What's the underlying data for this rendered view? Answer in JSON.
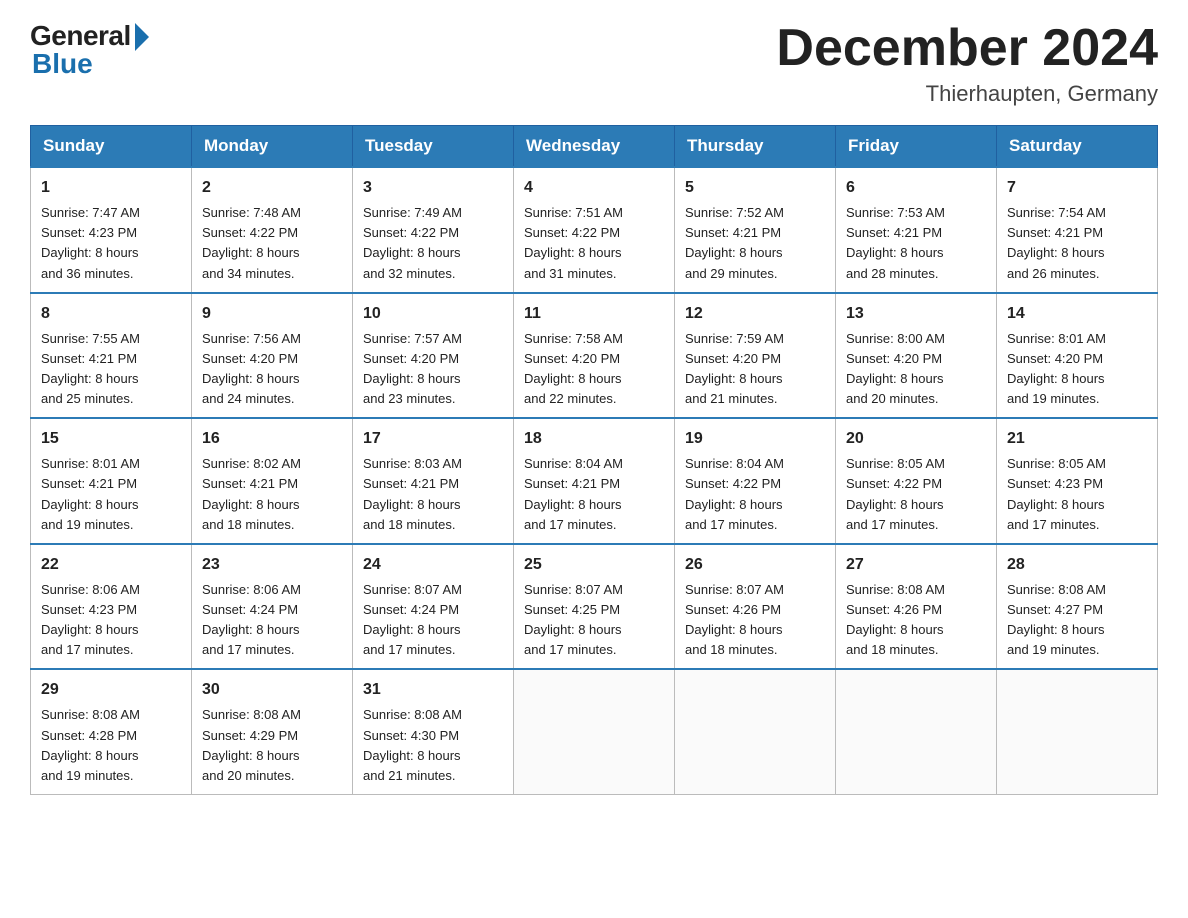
{
  "header": {
    "logo_general": "General",
    "logo_blue": "Blue",
    "month_title": "December 2024",
    "location": "Thierhaupten, Germany"
  },
  "days_of_week": [
    "Sunday",
    "Monday",
    "Tuesday",
    "Wednesday",
    "Thursday",
    "Friday",
    "Saturday"
  ],
  "weeks": [
    [
      {
        "num": "1",
        "sunrise": "7:47 AM",
        "sunset": "4:23 PM",
        "daylight": "8 hours and 36 minutes."
      },
      {
        "num": "2",
        "sunrise": "7:48 AM",
        "sunset": "4:22 PM",
        "daylight": "8 hours and 34 minutes."
      },
      {
        "num": "3",
        "sunrise": "7:49 AM",
        "sunset": "4:22 PM",
        "daylight": "8 hours and 32 minutes."
      },
      {
        "num": "4",
        "sunrise": "7:51 AM",
        "sunset": "4:22 PM",
        "daylight": "8 hours and 31 minutes."
      },
      {
        "num": "5",
        "sunrise": "7:52 AM",
        "sunset": "4:21 PM",
        "daylight": "8 hours and 29 minutes."
      },
      {
        "num": "6",
        "sunrise": "7:53 AM",
        "sunset": "4:21 PM",
        "daylight": "8 hours and 28 minutes."
      },
      {
        "num": "7",
        "sunrise": "7:54 AM",
        "sunset": "4:21 PM",
        "daylight": "8 hours and 26 minutes."
      }
    ],
    [
      {
        "num": "8",
        "sunrise": "7:55 AM",
        "sunset": "4:21 PM",
        "daylight": "8 hours and 25 minutes."
      },
      {
        "num": "9",
        "sunrise": "7:56 AM",
        "sunset": "4:20 PM",
        "daylight": "8 hours and 24 minutes."
      },
      {
        "num": "10",
        "sunrise": "7:57 AM",
        "sunset": "4:20 PM",
        "daylight": "8 hours and 23 minutes."
      },
      {
        "num": "11",
        "sunrise": "7:58 AM",
        "sunset": "4:20 PM",
        "daylight": "8 hours and 22 minutes."
      },
      {
        "num": "12",
        "sunrise": "7:59 AM",
        "sunset": "4:20 PM",
        "daylight": "8 hours and 21 minutes."
      },
      {
        "num": "13",
        "sunrise": "8:00 AM",
        "sunset": "4:20 PM",
        "daylight": "8 hours and 20 minutes."
      },
      {
        "num": "14",
        "sunrise": "8:01 AM",
        "sunset": "4:20 PM",
        "daylight": "8 hours and 19 minutes."
      }
    ],
    [
      {
        "num": "15",
        "sunrise": "8:01 AM",
        "sunset": "4:21 PM",
        "daylight": "8 hours and 19 minutes."
      },
      {
        "num": "16",
        "sunrise": "8:02 AM",
        "sunset": "4:21 PM",
        "daylight": "8 hours and 18 minutes."
      },
      {
        "num": "17",
        "sunrise": "8:03 AM",
        "sunset": "4:21 PM",
        "daylight": "8 hours and 18 minutes."
      },
      {
        "num": "18",
        "sunrise": "8:04 AM",
        "sunset": "4:21 PM",
        "daylight": "8 hours and 17 minutes."
      },
      {
        "num": "19",
        "sunrise": "8:04 AM",
        "sunset": "4:22 PM",
        "daylight": "8 hours and 17 minutes."
      },
      {
        "num": "20",
        "sunrise": "8:05 AM",
        "sunset": "4:22 PM",
        "daylight": "8 hours and 17 minutes."
      },
      {
        "num": "21",
        "sunrise": "8:05 AM",
        "sunset": "4:23 PM",
        "daylight": "8 hours and 17 minutes."
      }
    ],
    [
      {
        "num": "22",
        "sunrise": "8:06 AM",
        "sunset": "4:23 PM",
        "daylight": "8 hours and 17 minutes."
      },
      {
        "num": "23",
        "sunrise": "8:06 AM",
        "sunset": "4:24 PM",
        "daylight": "8 hours and 17 minutes."
      },
      {
        "num": "24",
        "sunrise": "8:07 AM",
        "sunset": "4:24 PM",
        "daylight": "8 hours and 17 minutes."
      },
      {
        "num": "25",
        "sunrise": "8:07 AM",
        "sunset": "4:25 PM",
        "daylight": "8 hours and 17 minutes."
      },
      {
        "num": "26",
        "sunrise": "8:07 AM",
        "sunset": "4:26 PM",
        "daylight": "8 hours and 18 minutes."
      },
      {
        "num": "27",
        "sunrise": "8:08 AM",
        "sunset": "4:26 PM",
        "daylight": "8 hours and 18 minutes."
      },
      {
        "num": "28",
        "sunrise": "8:08 AM",
        "sunset": "4:27 PM",
        "daylight": "8 hours and 19 minutes."
      }
    ],
    [
      {
        "num": "29",
        "sunrise": "8:08 AM",
        "sunset": "4:28 PM",
        "daylight": "8 hours and 19 minutes."
      },
      {
        "num": "30",
        "sunrise": "8:08 AM",
        "sunset": "4:29 PM",
        "daylight": "8 hours and 20 minutes."
      },
      {
        "num": "31",
        "sunrise": "8:08 AM",
        "sunset": "4:30 PM",
        "daylight": "8 hours and 21 minutes."
      },
      null,
      null,
      null,
      null
    ]
  ],
  "labels": {
    "sunrise": "Sunrise:",
    "sunset": "Sunset:",
    "daylight": "Daylight:"
  }
}
